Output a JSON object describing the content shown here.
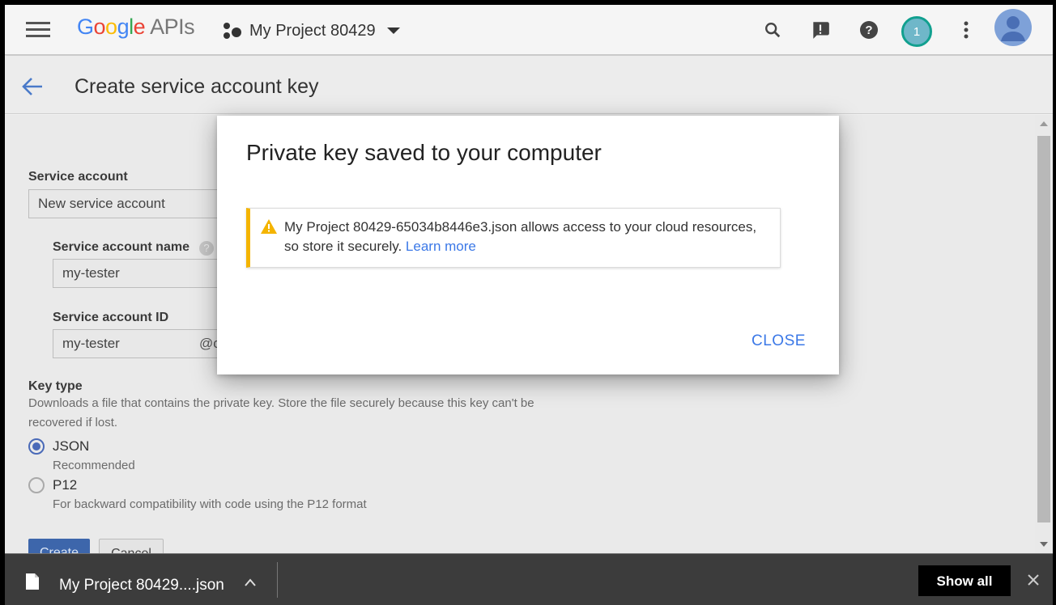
{
  "header": {
    "logo_google": "Google",
    "logo_apis": "APIs",
    "project_name": "My Project 80429",
    "notification_count": "1"
  },
  "page": {
    "title": "Create service account key"
  },
  "form": {
    "service_account_label": "Service account",
    "service_account_value": "New service account",
    "name_label": "Service account name",
    "name_value": "my-tester",
    "id_label": "Service account ID",
    "id_value": "my-tester",
    "id_suffix": "@c",
    "key_type_label": "Key type",
    "key_type_desc": "Downloads a file that contains the private key. Store the file securely because this key can't be recovered if lost.",
    "options": [
      {
        "label": "JSON",
        "sub": "Recommended",
        "selected": true
      },
      {
        "label": "P12",
        "sub": "For backward compatibility with code using the P12 format",
        "selected": false
      }
    ],
    "create_label": "Create",
    "cancel_label": "Cancel"
  },
  "dialog": {
    "title": "Private key saved to your computer",
    "message": "My Project 80429-65034b8446e3.json allows access to your cloud resources, so store it securely.",
    "learn_more": "Learn more",
    "close_label": "CLOSE"
  },
  "download_bar": {
    "file_name": "My Project 80429....json",
    "show_all": "Show all"
  },
  "colors": {
    "accent_blue": "#3b78e7",
    "warning_yellow": "#f4b400",
    "download_bar": "#3c3c3c"
  },
  "icons": [
    "menu-icon",
    "search-icon",
    "feedback-icon",
    "help-icon",
    "more-vert-icon",
    "avatar-icon",
    "back-arrow-icon",
    "warning-icon",
    "file-icon",
    "chevron-up-icon",
    "close-icon"
  ]
}
